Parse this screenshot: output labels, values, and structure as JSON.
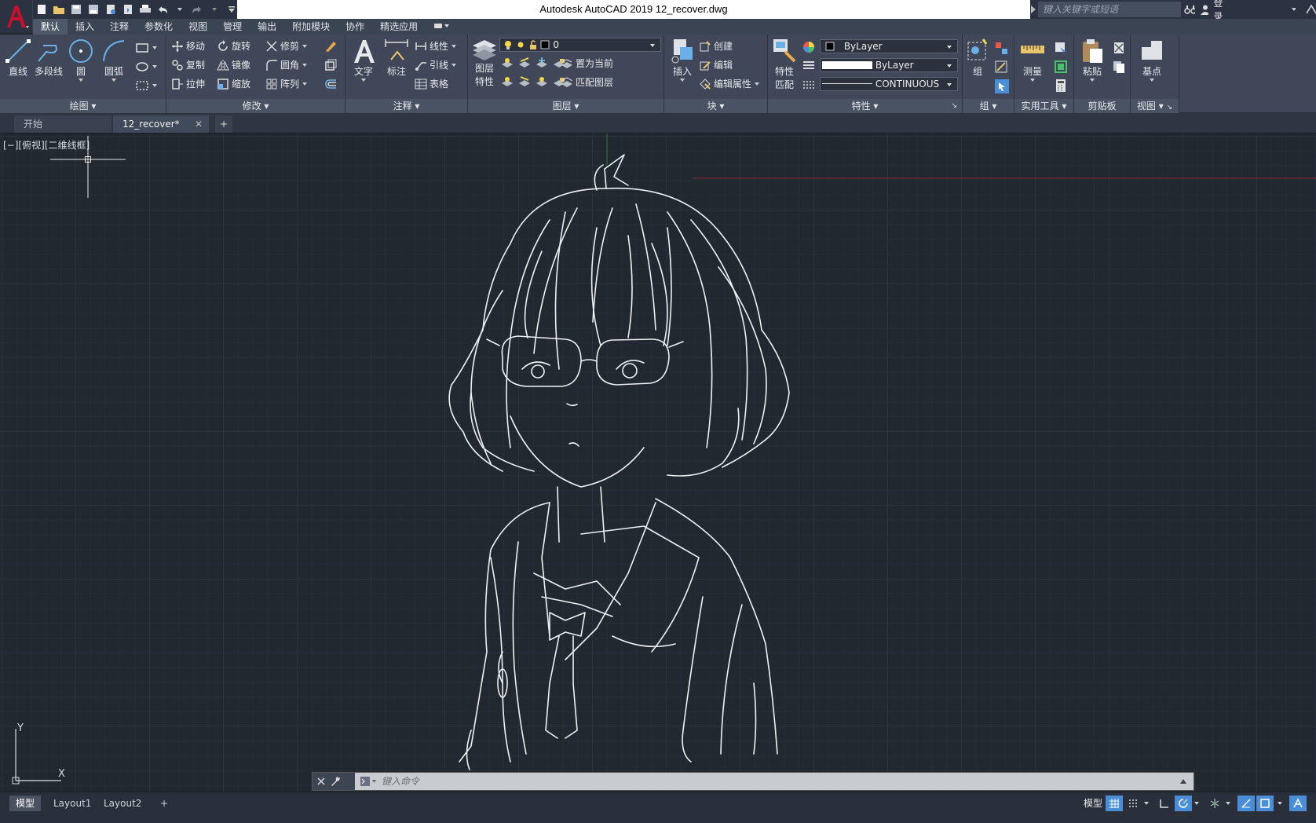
{
  "window": {
    "title": "Autodesk AutoCAD 2019    12_recover.dwg",
    "search_placeholder": "键入关键字或短语",
    "login_label": "登录"
  },
  "ribbon_tabs": [
    "默认",
    "插入",
    "注释",
    "参数化",
    "视图",
    "管理",
    "输出",
    "附加模块",
    "协作",
    "精选应用"
  ],
  "panels": {
    "draw": {
      "title": "绘图",
      "line": "直线",
      "polyline": "多段线",
      "circle": "圆",
      "arc": "圆弧"
    },
    "modify": {
      "title": "修改",
      "move": "移动",
      "rotate": "旋转",
      "trim": "修剪",
      "copy": "复制",
      "mirror": "镜像",
      "fillet": "圆角",
      "stretch": "拉伸",
      "scale": "缩放",
      "array": "阵列"
    },
    "annotation": {
      "title": "注释",
      "text": "文字",
      "dimension": "标注",
      "linear": "线性",
      "leader": "引线",
      "table": "表格"
    },
    "layers": {
      "title": "图层",
      "layer_props_1": "图层",
      "layer_props_2": "特性",
      "current_layer": "0",
      "set_current": "置为当前",
      "match_layer": "匹配图层"
    },
    "block": {
      "title": "块",
      "insert": "插入",
      "create": "创建",
      "edit": "编辑",
      "edit_attr": "编辑属性"
    },
    "properties": {
      "title": "特性",
      "match_1": "特性",
      "match_2": "匹配",
      "color": "ByLayer",
      "lineweight": "ByLayer",
      "linetype": "CONTINUOUS"
    },
    "groups": {
      "title": "组",
      "group": "组"
    },
    "utilities": {
      "title": "实用工具",
      "measure": "测量"
    },
    "clipboard": {
      "title": "剪贴板",
      "paste": "粘贴"
    },
    "view": {
      "title": "视图",
      "base": "基点"
    }
  },
  "doc_tabs": {
    "start": "开始",
    "current": "12_recover*"
  },
  "viewport_label": "[−][俯视][二维线框]",
  "ucs": {
    "x": "X",
    "y": "Y"
  },
  "command_placeholder": "键入命令",
  "layout_tabs": [
    "模型",
    "Layout1",
    "Layout2"
  ],
  "status": {
    "model": "模型"
  }
}
